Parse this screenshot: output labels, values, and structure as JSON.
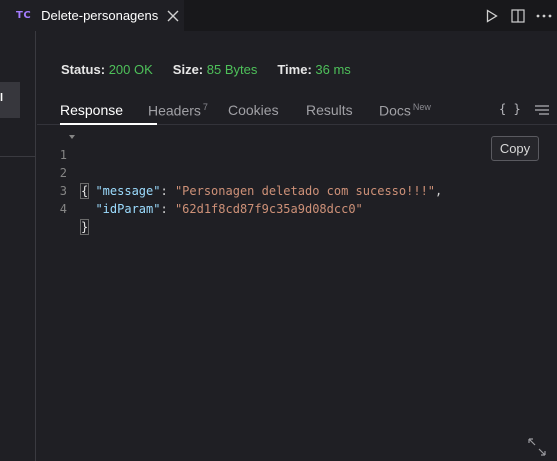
{
  "tab": {
    "logo": "TC",
    "title": "Delete-personagens"
  },
  "sidebar": {
    "active_item_label": "l"
  },
  "status": {
    "status_label": "Status:",
    "status_value": "200 OK",
    "size_label": "Size:",
    "size_value": "85 Bytes",
    "time_label": "Time:",
    "time_value": "36 ms"
  },
  "response_tabs": [
    {
      "label": "Response"
    },
    {
      "label": "Headers",
      "badge": "7"
    },
    {
      "label": "Cookies"
    },
    {
      "label": "Results"
    },
    {
      "label": "Docs",
      "badge": "New"
    }
  ],
  "toolbar": {
    "braces_label": "{ }"
  },
  "editor": {
    "lines": [
      {
        "num": "1",
        "text": "{"
      },
      {
        "num": "2",
        "key": "\"message\"",
        "sep": ": ",
        "value": "\"Personagen deletado com sucesso!!!\"",
        "tail": ","
      },
      {
        "num": "3",
        "key": "\"idParam\"",
        "sep": ": ",
        "value": "\"62d1f8cd87f9c35a9d08dcc0\"",
        "tail": ""
      },
      {
        "num": "4",
        "text": "}"
      }
    ]
  },
  "copy_button": {
    "label": "Copy"
  },
  "colors": {
    "accent_green": "#4ec05a",
    "json_key": "#9cdcfe",
    "json_string": "#ce9178",
    "logo_purple": "#a47cff"
  }
}
